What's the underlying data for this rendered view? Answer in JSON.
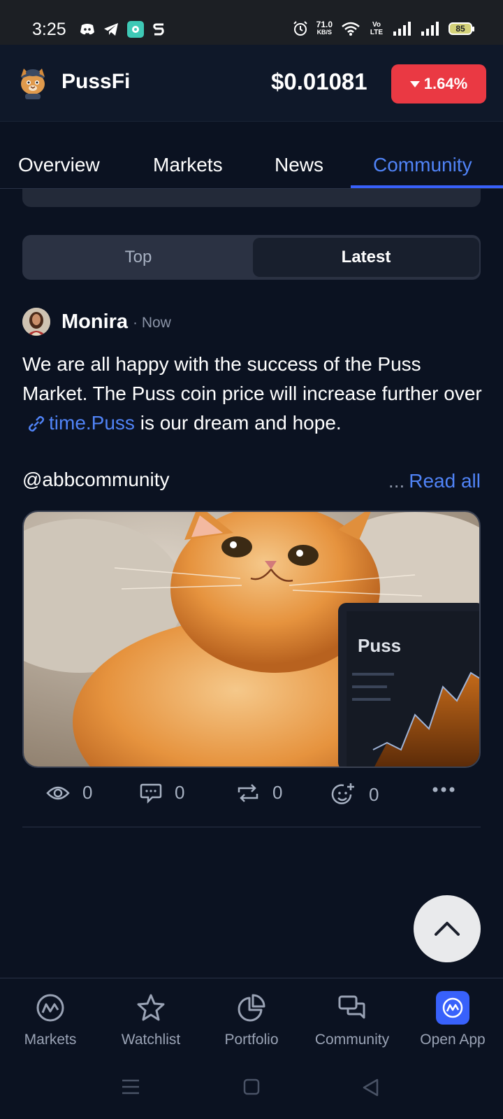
{
  "status_bar": {
    "time": "3:25",
    "net_speed_value": "71.0",
    "net_speed_unit": "KB/S",
    "volte": "Vo LTE",
    "battery": "85"
  },
  "header": {
    "coin_name": "PussFi",
    "price": "$0.01081",
    "change": "1.64%",
    "change_color": "#ea3943"
  },
  "tabs": [
    {
      "label": "Overview"
    },
    {
      "label": "Markets"
    },
    {
      "label": "News"
    },
    {
      "label": "Community",
      "active": true
    }
  ],
  "feed_filter": {
    "top": "Top",
    "latest": "Latest",
    "selected": "Latest"
  },
  "post": {
    "author": "Monira",
    "time": "· Now",
    "body_part1": "We are all happy with the success of the Puss Market. The Puss coin price will increase further over",
    "link_text": "time.Puss",
    "body_part2": "is our dream and hope.",
    "handle": "@abbcommunity",
    "read_all_dots": "...",
    "read_all": "Read all",
    "image_text": "Puss",
    "stats": {
      "views": "0",
      "comments": "0",
      "reposts": "0",
      "reactions": "0"
    }
  },
  "bottom_nav": [
    {
      "label": "Markets",
      "icon": "markets-icon"
    },
    {
      "label": "Watchlist",
      "icon": "star-icon"
    },
    {
      "label": "Portfolio",
      "icon": "pie-chart-icon"
    },
    {
      "label": "Community",
      "icon": "chat-bubbles-icon"
    },
    {
      "label": "Open App",
      "icon": "app-logo-icon"
    }
  ],
  "colors": {
    "background": "#0b1221",
    "accent": "#3861fb",
    "link": "#5083f6",
    "negative": "#ea3943"
  }
}
